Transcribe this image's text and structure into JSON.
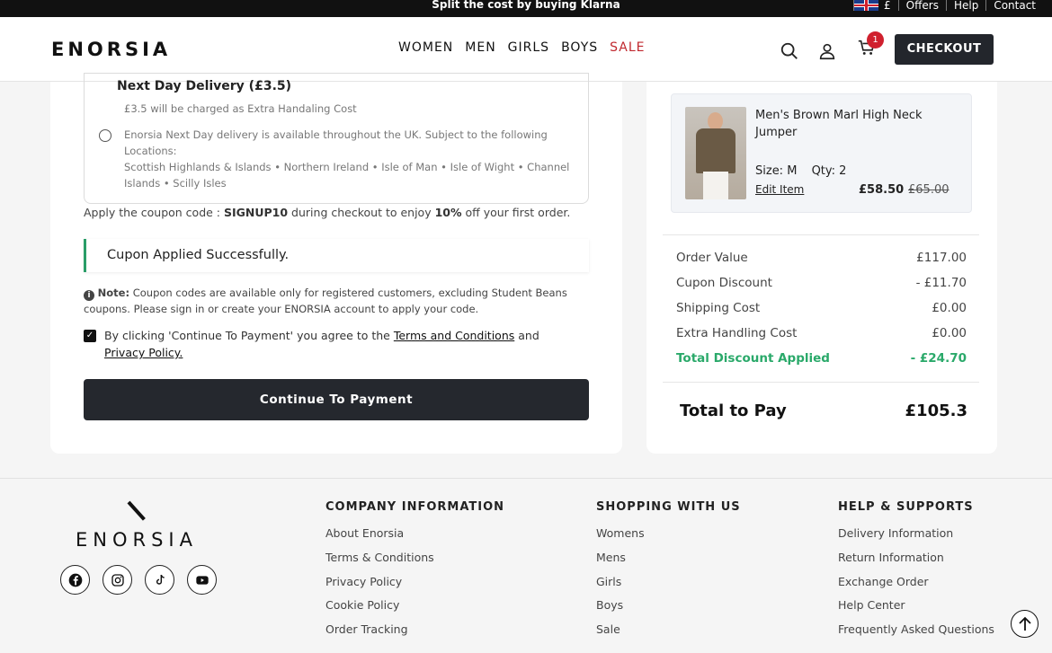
{
  "topbar": {
    "promo": "Split the cost by buying Klarna",
    "currency": "£",
    "links": [
      "Offers",
      "Help",
      "Contact"
    ]
  },
  "header": {
    "logo": "ENORSIA",
    "nav": [
      "WOMEN",
      "MEN",
      "GIRLS",
      "BOYS",
      "SALE"
    ],
    "cart_count": "1",
    "checkout_label": "CHECKOUT"
  },
  "checkout": {
    "delivery_title": "Next Day Delivery (£3.5)",
    "delivery_note": "£3.5 will be charged as Extra Handaling Cost",
    "delivery_desc_1": "Enorsia Next Day delivery is available throughout the UK. Subject to the following Locations:",
    "delivery_desc_2": "Scottish Highlands & Islands • Northern Ireland • Isle of Man • Isle of Wight • Channel Islands • Scilly Isles",
    "coupon_prefix": "Apply the coupon code : ",
    "coupon_code": "SIGNUP10",
    "coupon_mid": " during checkout to enjoy ",
    "coupon_pct": "10%",
    "coupon_suffix": " off your first order.",
    "success_message": "Cupon Applied Successfully.",
    "note_label": "Note:",
    "note_text": " Coupon codes are available only for registered customers, excluding Student Beans coupons. Please sign in or create your ENORSIA account to apply your code.",
    "agree_prefix": "By clicking 'Continue To Payment' you agree to the ",
    "terms_link": "Terms and Conditions",
    "agree_and": " and ",
    "privacy_link": "Privacy Policy.",
    "pay_button": "Continue To Payment"
  },
  "order": {
    "item": {
      "name": "Men's Brown Marl High Neck Jumper",
      "size": "Size: M",
      "qty": "Qty: 2",
      "edit": "Edit Item",
      "price": "£58.50",
      "old_price": "£65.00"
    },
    "summary": [
      {
        "label": "Order Value",
        "value": "£117.00"
      },
      {
        "label": "Cupon Discount",
        "value": "- £11.70"
      },
      {
        "label": "Shipping Cost",
        "value": "£0.00"
      },
      {
        "label": "Extra Handling Cost",
        "value": "£0.00"
      },
      {
        "label": "Total Discount Applied",
        "value": "- £24.70"
      }
    ],
    "total_label": "Total to Pay",
    "total_value": "£105.3"
  },
  "footer": {
    "logo": "ENORSIA",
    "columns": [
      {
        "title": "COMPANY INFORMATION",
        "links": [
          "About Enorsia",
          "Terms & Conditions",
          "Privacy Policy",
          "Cookie Policy",
          "Order Tracking"
        ]
      },
      {
        "title": "SHOPPING WITH US",
        "links": [
          "Womens",
          "Mens",
          "Girls",
          "Boys",
          "Sale"
        ]
      },
      {
        "title": "HELP & SUPPORTS",
        "links": [
          "Delivery Information",
          "Return Information",
          "Exchange Order",
          "Help Center",
          "Frequently Asked Questions"
        ]
      }
    ]
  },
  "colors": {
    "accent_dark": "#23262c",
    "sale_red": "#c0282e",
    "success_green": "#2aa96a"
  }
}
